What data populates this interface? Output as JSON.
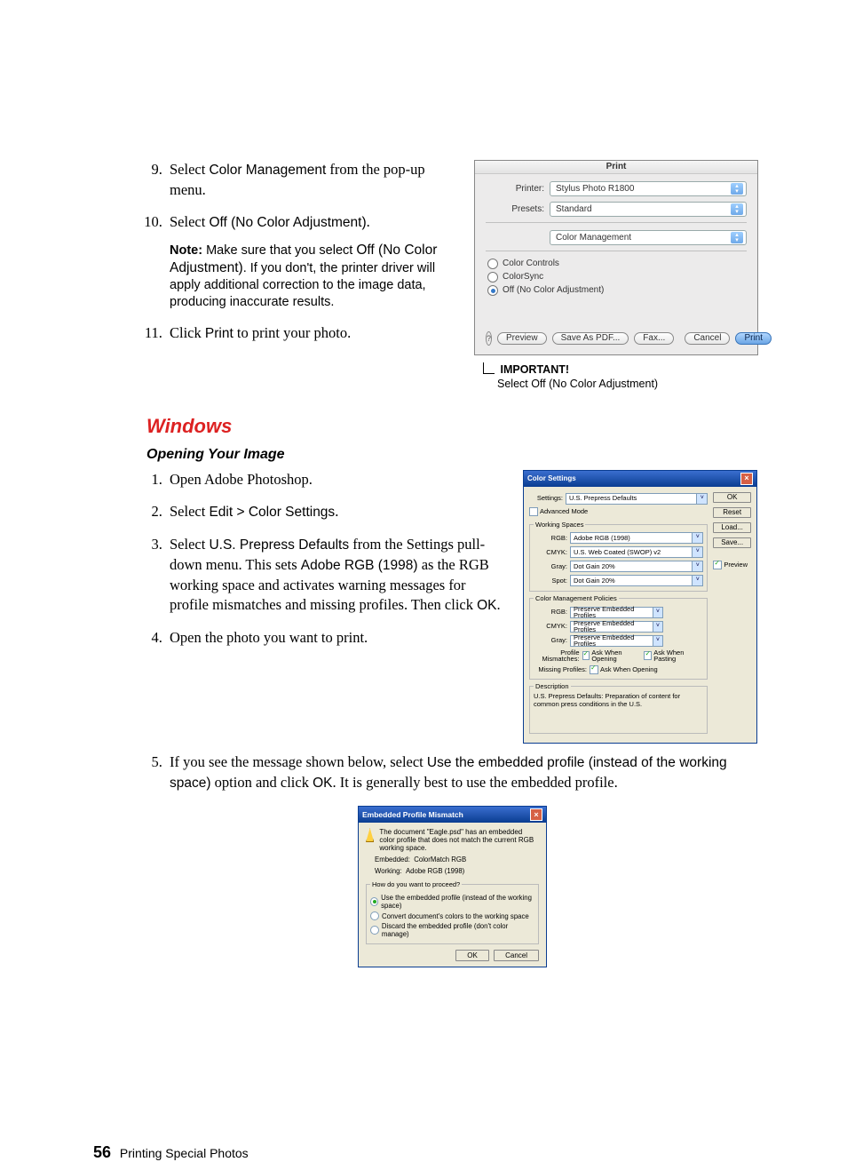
{
  "steps_top": {
    "s9_a": "Select ",
    "s9_b": "Color Management",
    "s9_c": " from the pop-up menu.",
    "s10_a": "Select ",
    "s10_b": "Off (No Color Adjustment)",
    "s10_c": ".",
    "note_label": "Note:",
    "note_a": " Make sure that you select ",
    "note_b": "Off (No Color Adjustment)",
    "note_c": ". If you don't, the printer driver will apply additional correction to the image data, producing inaccurate results.",
    "s11_a": "Click ",
    "s11_b": "Print",
    "s11_c": " to print your photo."
  },
  "mac": {
    "title": "Print",
    "printer_label": "Printer:",
    "printer_value": "Stylus Photo R1800",
    "presets_label": "Presets:",
    "presets_value": "Standard",
    "section_value": "Color Management",
    "radios": [
      "Color Controls",
      "ColorSync",
      "Off (No Color Adjustment)"
    ],
    "help": "?",
    "btn_preview": "Preview",
    "btn_saveaspdf": "Save As PDF...",
    "btn_fax": "Fax...",
    "btn_cancel": "Cancel",
    "btn_print": "Print",
    "callout_head": "IMPORTANT!",
    "callout_text": "Select Off (No Color Adjustment)"
  },
  "section_windows": "Windows",
  "sub_opening": "Opening Your Image",
  "winsteps": {
    "s1": "Open Adobe Photoshop.",
    "s2_a": "Select ",
    "s2_b": "Edit > Color Settings",
    "s2_c": ".",
    "s3_a": "Select ",
    "s3_b": "U.S. Prepress Defaults",
    "s3_c": " from the Settings pull-down menu. This sets ",
    "s3_d": "Adobe RGB (1998)",
    "s3_e": " as the RGB working space and activates warning messages for profile mismatches and missing profiles. Then click ",
    "s3_f": "OK",
    "s3_g": ".",
    "s4": "Open the photo you want to print.",
    "s5_a": "If you see the message shown below, select ",
    "s5_b": "Use the embedded profile (instead of the working space)",
    "s5_c": " option and click ",
    "s5_d": "OK",
    "s5_e": ". It is generally best to use the embedded profile."
  },
  "color_settings": {
    "title": "Color Settings",
    "settings_label": "Settings:",
    "settings_value": "U.S. Prepress Defaults",
    "advanced": "Advanced Mode",
    "working_spaces": "Working Spaces",
    "rows_ws": [
      {
        "label": "RGB:",
        "value": "Adobe RGB (1998)"
      },
      {
        "label": "CMYK:",
        "value": "U.S. Web Coated (SWOP) v2"
      },
      {
        "label": "Gray:",
        "value": "Dot Gain 20%"
      },
      {
        "label": "Spot:",
        "value": "Dot Gain 20%"
      }
    ],
    "cmp": "Color Management Policies",
    "rows_cmp": [
      {
        "label": "RGB:",
        "value": "Preserve Embedded Profiles"
      },
      {
        "label": "CMYK:",
        "value": "Preserve Embedded Profiles"
      },
      {
        "label": "Gray:",
        "value": "Preserve Embedded Profiles"
      }
    ],
    "mismatch_label": "Profile Mismatches:",
    "mismatch_a": "Ask When Opening",
    "mismatch_b": "Ask When Pasting",
    "missing_label": "Missing Profiles:",
    "missing_a": "Ask When Opening",
    "desc_title": "Description",
    "desc_text": "U.S. Prepress Defaults:  Preparation of content for common press conditions in the U.S.",
    "btn_ok": "OK",
    "btn_reset": "Reset",
    "btn_load": "Load...",
    "btn_save": "Save...",
    "preview": "Preview"
  },
  "mismatch_dialog": {
    "title": "Embedded Profile Mismatch",
    "msg": "The document \"Eagle.psd\" has an embedded color profile that does not match the current RGB working space.",
    "embedded_label": "Embedded:",
    "embedded_value": "ColorMatch RGB",
    "working_label": "Working:",
    "working_value": "Adobe RGB (1998)",
    "group": "How do you want to proceed?",
    "opt1": "Use the embedded profile (instead of the working space)",
    "opt2": "Convert document's colors to the working space",
    "opt3": "Discard the embedded profile (don't color manage)",
    "ok": "OK",
    "cancel": "Cancel"
  },
  "footer": {
    "page": "56",
    "title": "Printing Special Photos"
  }
}
